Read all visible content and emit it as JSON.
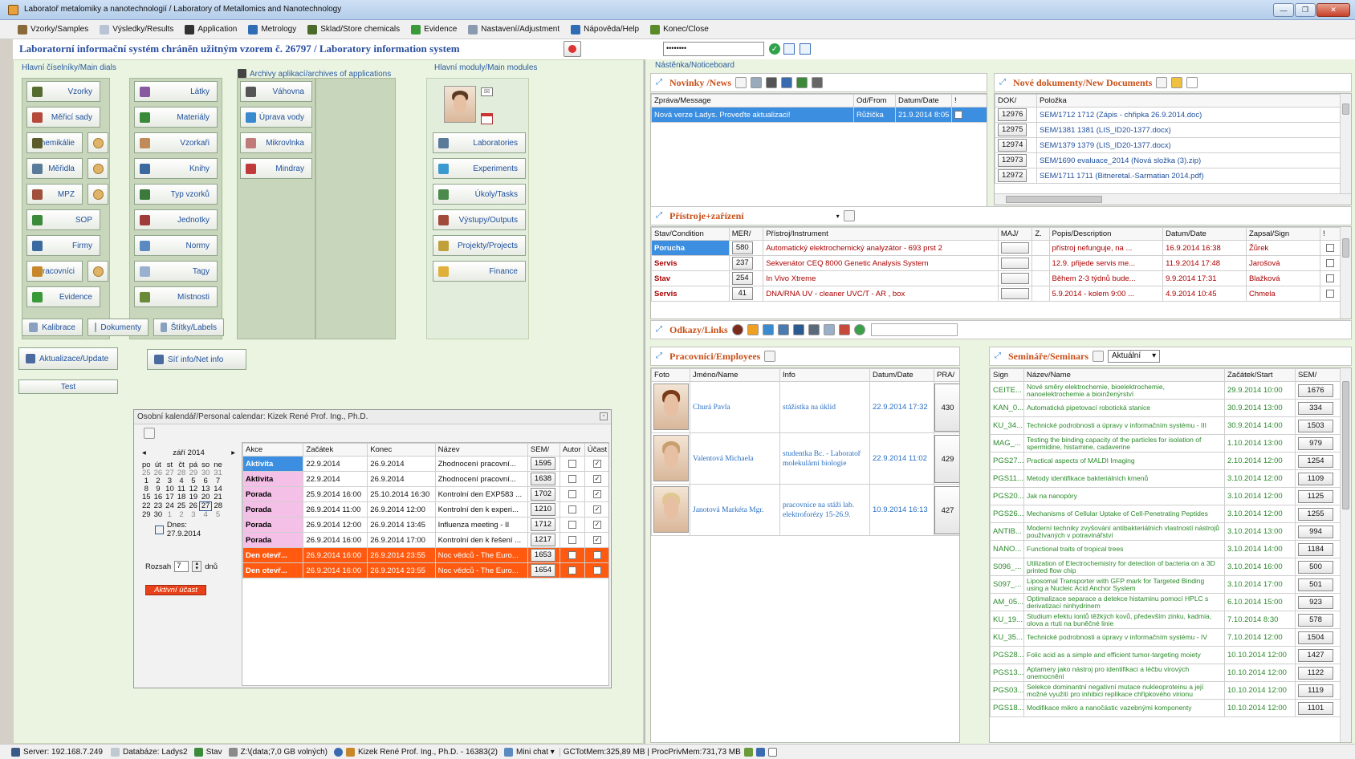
{
  "window": {
    "title": "Laboratoř metalomiky a nanotechnologií / Laboratory of Metallomics and Nanotechnology",
    "min": "—",
    "max": "❐",
    "close": "✕"
  },
  "menu": [
    {
      "label": "Vzorky/Samples",
      "color": "#8a6a3a"
    },
    {
      "label": "Výsledky/Results",
      "color": "#b8c4d6"
    },
    {
      "label": "Application",
      "color": "#333333"
    },
    {
      "label": "Metrology",
      "color": "#2f6db5"
    },
    {
      "label": "Sklad/Store chemicals",
      "color": "#4a6b2a"
    },
    {
      "label": "Evidence",
      "color": "#3a9a3a"
    },
    {
      "label": "Nastavení/Adjustment",
      "color": "#8a9ab0"
    },
    {
      "label": "Nápověda/Help",
      "color": "#2f6db5"
    },
    {
      "label": "Konec/Close",
      "color": "#5a8a2a"
    }
  ],
  "banner": {
    "text": "Laboratorní informační systém chráněn užitným vzorem č. 26797 / Laboratory information system",
    "password": "••••••••"
  },
  "left": {
    "main_dials_label": "Hlavní číselníky/Main dials",
    "archives_label": "Archivy aplikací/archives of applications",
    "modules_label": "Hlavní moduly/Main modules",
    "col1": [
      {
        "label": "Vzorky",
        "color": "#556b2f"
      },
      {
        "label": "Měřicí sady",
        "color": "#b5493a"
      },
      {
        "label": "Chemikálie",
        "color": "#5a5a2a"
      },
      {
        "label": "Měřidla",
        "color": "#5a7a9a"
      },
      {
        "label": "MPZ",
        "color": "#a0503a"
      },
      {
        "label": "SOP",
        "color": "#3a8a3a"
      },
      {
        "label": "Firmy",
        "color": "#3a6aa0"
      },
      {
        "label": "Pracovníci",
        "color": "#c8862a"
      },
      {
        "label": "Evidence",
        "color": "#3a9a3a"
      }
    ],
    "col2": [
      {
        "label": "Látky",
        "color": "#8a5aa0"
      },
      {
        "label": "Materiály",
        "color": "#3a8a3a"
      },
      {
        "label": "Vzorkaři",
        "color": "#c08a5a"
      },
      {
        "label": "Knihy",
        "color": "#3a6aa0"
      },
      {
        "label": "Typ vzorků",
        "color": "#3a7a3a"
      },
      {
        "label": "Jednotky",
        "color": "#a03a3a"
      },
      {
        "label": "Normy",
        "color": "#5a8ac0"
      },
      {
        "label": "Tagy",
        "color": "#9ab0d0"
      },
      {
        "label": "Místnosti",
        "color": "#6a8a3a"
      }
    ],
    "archives": [
      {
        "label": "Váhovna",
        "color": "#555555"
      },
      {
        "label": "Úprava vody",
        "color": "#3a8ad0"
      },
      {
        "label": "Mikrovlnka",
        "color": "#c07a7a"
      },
      {
        "label": "Mindray",
        "color": "#c03a3a"
      }
    ],
    "modules": [
      {
        "label": "Laboratories",
        "color": "#5a7a9a"
      },
      {
        "label": "Experiments",
        "color": "#3a9ad0"
      },
      {
        "label": "Úkoly/Tasks",
        "color": "#4a8a4a"
      },
      {
        "label": "Výstupy/Outputs",
        "color": "#a04a3a"
      },
      {
        "label": "Projekty/Projects",
        "color": "#c0a03a"
      },
      {
        "label": "Finance",
        "color": "#e0b03a"
      }
    ],
    "bottom_buttons": [
      {
        "label": "Kalibrace"
      },
      {
        "label": "Dokumenty"
      },
      {
        "label": "Štítky/Labels"
      }
    ],
    "update_btn": "Aktualizace/Update",
    "netinfo_btn": "Síť info/Net info",
    "test_btn": "Test"
  },
  "calendar": {
    "title": "Osobní kalendář/Personal calendar: Kizek René Prof. Ing., Ph.D.",
    "month": "září 2014",
    "prev": "◂",
    "next": "▸",
    "dow": [
      "po",
      "út",
      "st",
      "čt",
      "pá",
      "so",
      "ne"
    ],
    "weeks": [
      [
        "25",
        "26",
        "27",
        "28",
        "29",
        "30",
        "31"
      ],
      [
        "1",
        "2",
        "3",
        "4",
        "5",
        "6",
        "7"
      ],
      [
        "8",
        "9",
        "10",
        "11",
        "12",
        "13",
        "14"
      ],
      [
        "15",
        "16",
        "17",
        "18",
        "19",
        "20",
        "21"
      ],
      [
        "22",
        "23",
        "24",
        "25",
        "26",
        "27",
        "28"
      ],
      [
        "29",
        "30",
        "1",
        "2",
        "3",
        "4",
        "5"
      ]
    ],
    "today": "Dnes: 27.9.2014",
    "range_label": "Rozsah",
    "range_value": "7",
    "range_unit": "dnů",
    "active_badge": "Aktivní účast",
    "columns": [
      "Akce",
      "Začátek",
      "Konec",
      "Název",
      "SEM/",
      "Autor",
      "Účast"
    ],
    "rows": [
      {
        "akce": "Aktivita",
        "start": "22.9.2014",
        "end": "26.9.2014",
        "name": "Zhodnocení pracovní...",
        "sem": "1595",
        "autor": "",
        "ucast": "✓",
        "style": "aktivita-sel"
      },
      {
        "akce": "Aktivita",
        "start": "22.9.2014",
        "end": "26.9.2014",
        "name": "Zhodnocení pracovní...",
        "sem": "1638",
        "autor": "",
        "ucast": "✓",
        "style": "aktivita"
      },
      {
        "akce": "Porada",
        "start": "25.9.2014 16:00",
        "end": "25.10.2014 16:30",
        "name": "Kontrolní den EXP583 ...",
        "sem": "1702",
        "autor": "",
        "ucast": "✓",
        "style": "porada"
      },
      {
        "akce": "Porada",
        "start": "26.9.2014 11:00",
        "end": "26.9.2014 12:00",
        "name": "Kontrolní den k experi...",
        "sem": "1210",
        "autor": "",
        "ucast": "✓",
        "style": "porada"
      },
      {
        "akce": "Porada",
        "start": "26.9.2014 12:00",
        "end": "26.9.2014 13:45",
        "name": "Influenza meeting - II",
        "sem": "1712",
        "autor": "",
        "ucast": "✓",
        "style": "porada"
      },
      {
        "akce": "Porada",
        "start": "26.9.2014 16:00",
        "end": "26.9.2014 17:00",
        "name": "Kontrolní den k řešení ...",
        "sem": "1217",
        "autor": "",
        "ucast": "✓",
        "style": "porada"
      },
      {
        "akce": "Den otevř...",
        "start": "26.9.2014 16:00",
        "end": "26.9.2014 23:55",
        "name": "Noc vědců - The Euro...",
        "sem": "1653",
        "autor": "✓",
        "ucast": "✓",
        "style": "den"
      },
      {
        "akce": "Den otevř...",
        "start": "26.9.2014 16:00",
        "end": "26.9.2014 23:55",
        "name": "Noc vědců - The Euro...",
        "sem": "1654",
        "autor": "✓",
        "ucast": "✓",
        "style": "den"
      }
    ]
  },
  "noticeboard": {
    "label": "Nástěnka/Noticeboard"
  },
  "news": {
    "title": "Novinky /News",
    "columns": [
      "Zpráva/Message",
      "Od/From",
      "Datum/Date",
      "!"
    ],
    "rows": [
      {
        "message": "Nová verze Ladys. Proveďte aktualizaci!",
        "from": "Růžička",
        "date": "21.9.2014 8:05"
      }
    ]
  },
  "docs": {
    "title": "Nové dokumenty/New Documents",
    "columns": [
      "DOK/",
      "Položka"
    ],
    "rows": [
      {
        "id": "12976",
        "item": "SEM/1712 1712 (Zápis - chřipka 26.9.2014.doc)"
      },
      {
        "id": "12975",
        "item": "SEM/1381 1381 (LIS_ID20-1377.docx)"
      },
      {
        "id": "12974",
        "item": "SEM/1379 1379 (LIS_ID20-1377.docx)"
      },
      {
        "id": "12973",
        "item": "SEM/1690 evaluace_2014 (Nová složka (3).zip)"
      },
      {
        "id": "12972",
        "item": "SEM/1711 1711 (Bitneretal.-Sarmatian 2014.pdf)"
      }
    ]
  },
  "instruments": {
    "title": "Přístroje+zařízení",
    "columns": [
      "Stav/Condition",
      "MER/",
      "Přístroj/Instrument",
      "MAJ/",
      "Z.",
      "Popis/Description",
      "Datum/Date",
      "Zapsal/Sign",
      "!"
    ],
    "rows": [
      {
        "state": "Porucha",
        "mer": "580",
        "name": "Automatický elektrochemický analyzátor - 693 prst 2",
        "desc": "přístroj nefunguje, na ...",
        "date": "16.9.2014 16:38",
        "sign": "Žůrek",
        "sel": true
      },
      {
        "state": "Servis",
        "mer": "237",
        "name": "Sekvenátor CEQ 8000 Genetic Analysis System",
        "desc": "12.9. přijede servis me...",
        "date": "11.9.2014 17:48",
        "sign": "Jarošová",
        "sel": false
      },
      {
        "state": "Stav",
        "mer": "254",
        "name": "In Vivo Xtreme",
        "desc": "Během 2-3 týdnů bude...",
        "date": "9.9.2014 17:31",
        "sign": "Blažková",
        "sel": false
      },
      {
        "state": "Servis",
        "mer": "41",
        "name": "DNA/RNA UV - cleaner UVC/T - AR , box",
        "desc": "5.9.2014 - kolem 9:00 ...",
        "date": "4.9.2014 10:45",
        "sign": "Chmela",
        "sel": false
      }
    ]
  },
  "links": {
    "title": "Odkazy/Links"
  },
  "employees": {
    "title": "Pracovníci/Employees",
    "columns": [
      "Foto",
      "Jméno/Name",
      "Info",
      "Datum/Date",
      "PRA/"
    ],
    "rows": [
      {
        "name": "Churá Pavla",
        "info": "stážistka na úklid",
        "date": "22.9.2014 17:32",
        "id": "430",
        "hair": "#7a3a1a"
      },
      {
        "name": "Valentová Michaela",
        "info": "studentka Bc. - Laboratoř molekulární biologie",
        "date": "22.9.2014 11:02",
        "id": "429",
        "hair": "#c8a070"
      },
      {
        "name": "Janotová Markéta Mgr.",
        "info": "pracovnice na stáži lab. elektroforézy 15-26.9.",
        "date": "10.9.2014 16:13",
        "id": "427",
        "hair": "#e0c890"
      }
    ]
  },
  "seminars": {
    "title": "Semináře/Seminars",
    "filter": "Aktuální",
    "columns": [
      "Sign",
      "Název/Name",
      "Začátek/Start",
      "SEM/"
    ],
    "rows": [
      {
        "sign": "CEITE...",
        "name": "Nové směry elektrochemie, bioelektrochemie, nanoelektrochemie a bioinženýrství",
        "start": "29.9.2014 10:00",
        "id": "1676"
      },
      {
        "sign": "KAN_0...",
        "name": "Automatická pipetovací robotická stanice",
        "start": "30.9.2014 13:00",
        "id": "334"
      },
      {
        "sign": "KU_34...",
        "name": "Technické podrobnosti a úpravy v informačním systému - III",
        "start": "30.9.2014 14:00",
        "id": "1503"
      },
      {
        "sign": "MAG_...",
        "name": "Testing the binding capacity of the particles for isolation of spermidine, histamine, cadaverine",
        "start": "1.10.2014 13:00",
        "id": "979"
      },
      {
        "sign": "PGS27...",
        "name": "Practical aspects of MALDI Imaging",
        "start": "2.10.2014 12:00",
        "id": "1254"
      },
      {
        "sign": "PGS11...",
        "name": "Metody identifikace bakteriálních kmenů",
        "start": "3.10.2014 12:00",
        "id": "1109"
      },
      {
        "sign": "PGS20...",
        "name": "Jak na nanopóry",
        "start": "3.10.2014 12:00",
        "id": "1125"
      },
      {
        "sign": "PGS26...",
        "name": "Mechanisms of Cellular Uptake of Cell-Penetrating Peptides",
        "start": "3.10.2014 12:00",
        "id": "1255"
      },
      {
        "sign": "ANTIB...",
        "name": "Moderní techniky zvyšování antibakteriálních vlastností nástrojů používaných v potravinářství",
        "start": "3.10.2014 13:00",
        "id": "994"
      },
      {
        "sign": "NANO...",
        "name": "Functional traits of tropical trees",
        "start": "3.10.2014 14:00",
        "id": "1184"
      },
      {
        "sign": "S096_...",
        "name": "Utilization of Electrochemistry for detection of bacteria on a 3D printed flow chip",
        "start": "3.10.2014 16:00",
        "id": "500"
      },
      {
        "sign": "S097_...",
        "name": "Liposomal Transporter with GFP mark for Targeted Binding using a Nucleic Acid Anchor System",
        "start": "3.10.2014 17:00",
        "id": "501"
      },
      {
        "sign": "AM_05...",
        "name": "Optimalizace separace a detekce histaminu pomocí HPLC s derivatizací ninhydrinem",
        "start": "6.10.2014 15:00",
        "id": "923"
      },
      {
        "sign": "KU_19...",
        "name": "Studium efektu iontů těžkých kovů, především zinku, kadmia, olova a rtuti na buněčné linie",
        "start": "7.10.2014 8:30",
        "id": "578"
      },
      {
        "sign": "KU_35...",
        "name": "Technické podrobnosti a úpravy v informačním systému - IV",
        "start": "7.10.2014 12:00",
        "id": "1504"
      },
      {
        "sign": "PGS28...",
        "name": "Folic acid as a simple and efficient tumor-targeting moiety",
        "start": "10.10.2014 12:00",
        "id": "1427"
      },
      {
        "sign": "PGS13...",
        "name": "Aptamery jako nástroj pro identifikaci a léčbu virových onemocnění",
        "start": "10.10.2014 12:00",
        "id": "1122"
      },
      {
        "sign": "PGS03...",
        "name": "Selekce dominantní negativní mutace nukleoproteinu a její možné využití pro inhibici replikace chřipkového virionu",
        "start": "10.10.2014 12:00",
        "id": "1119"
      },
      {
        "sign": "PGS18...",
        "name": "Modifikace mikro a nanočástic vazebnými komponenty",
        "start": "10.10.2014 12:00",
        "id": "1101"
      }
    ]
  },
  "status": {
    "server": "Server: 192.168.7.249",
    "db": "Databáze: Ladys2",
    "state": "Stav",
    "disk": "Z:\\(data;7,0 GB volných)",
    "user": "Kizek René Prof. Ing., Ph.D. - 16383(2)",
    "chat": "Mini chat ▾",
    "mem": "GCTotMem:325,89 MB | ProcPrivMem:731,73 MB"
  }
}
